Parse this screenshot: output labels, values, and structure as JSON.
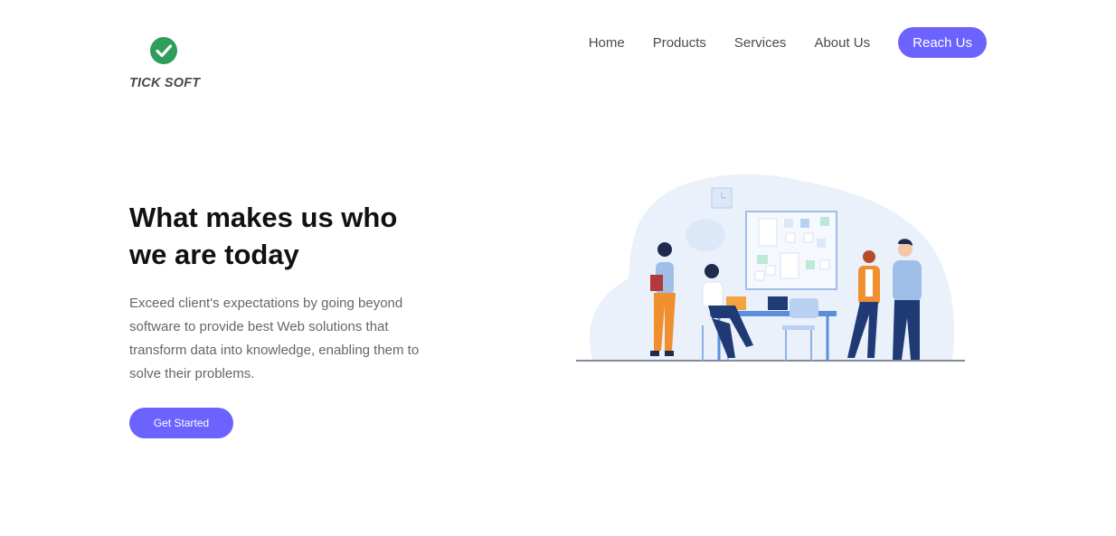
{
  "brand": {
    "name": "TICK SOFT",
    "icon": "check-circle-icon",
    "icon_color": "#2e9e5b"
  },
  "nav": {
    "links": [
      "Home",
      "Products",
      "Services",
      "About Us"
    ],
    "cta_label": "Reach Us"
  },
  "hero": {
    "title_line1": "What makes us who",
    "title_line2": "we are today",
    "description": "Exceed client's expectations by going beyond software to provide best Web solutions that transform data into knowledge, enabling them to solve their problems.",
    "cta_label": "Get Started"
  },
  "colors": {
    "accent": "#6c63ff",
    "illustration_bg": "#eaf1fb"
  }
}
